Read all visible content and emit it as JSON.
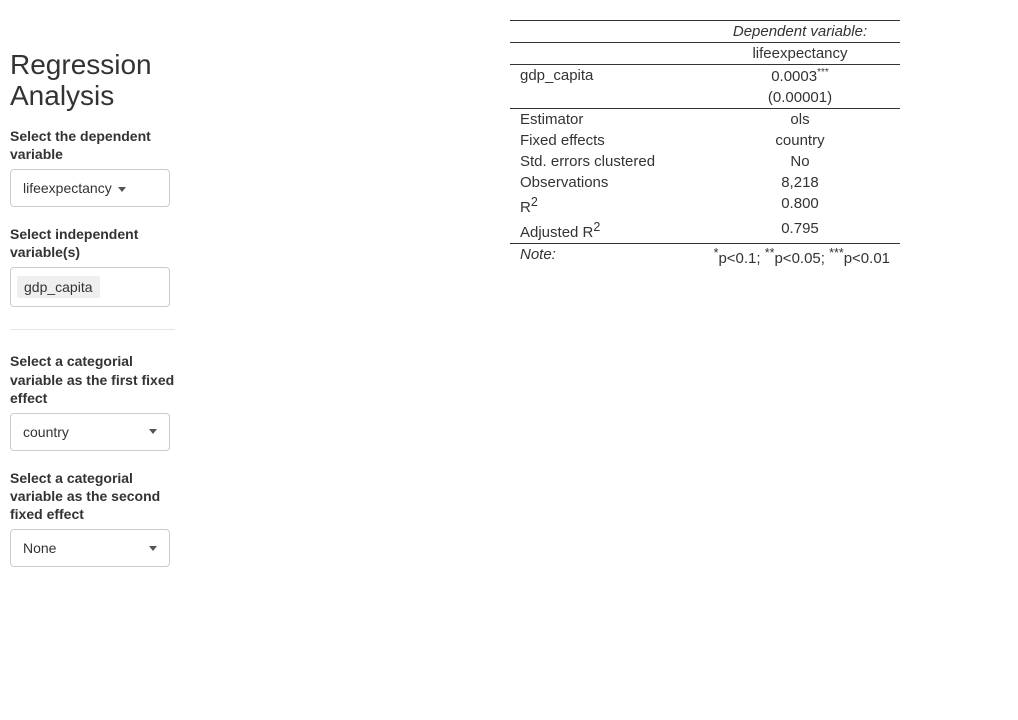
{
  "sidebar": {
    "title": "Regression Analysis",
    "depvar": {
      "label": "Select the dependent variable",
      "value": "lifeexpectancy"
    },
    "indepvar": {
      "label": "Select independent variable(s)",
      "tokens": [
        "gdp_capita"
      ]
    },
    "fe1": {
      "label": "Select a categorial variable as the first fixed effect",
      "value": "country"
    },
    "fe2": {
      "label": "Select a categorial variable as the second fixed effect",
      "value": "None"
    }
  },
  "results": {
    "dep_header": "Dependent variable:",
    "dep_name": "lifeexpectancy",
    "coef_rows": [
      {
        "name": "gdp_capita",
        "estimate": "0.0003",
        "stars": "***",
        "se": "(0.00001)"
      }
    ],
    "stats": [
      {
        "label": "Estimator",
        "value": "ols"
      },
      {
        "label": "Fixed effects",
        "value": "country"
      },
      {
        "label": "Std. errors clustered",
        "value": "No"
      },
      {
        "label": "Observations",
        "value": "8,218"
      },
      {
        "label_html": "R<sup>2</sup>",
        "label_plain": "R2",
        "value": "0.800"
      },
      {
        "label_html": "Adjusted R<sup>2</sup>",
        "label_plain": "Adjusted R2",
        "value": "0.795"
      }
    ],
    "note_label": "Note:",
    "note_text": "*p<0.1; **p<0.05; ***p<0.01"
  }
}
